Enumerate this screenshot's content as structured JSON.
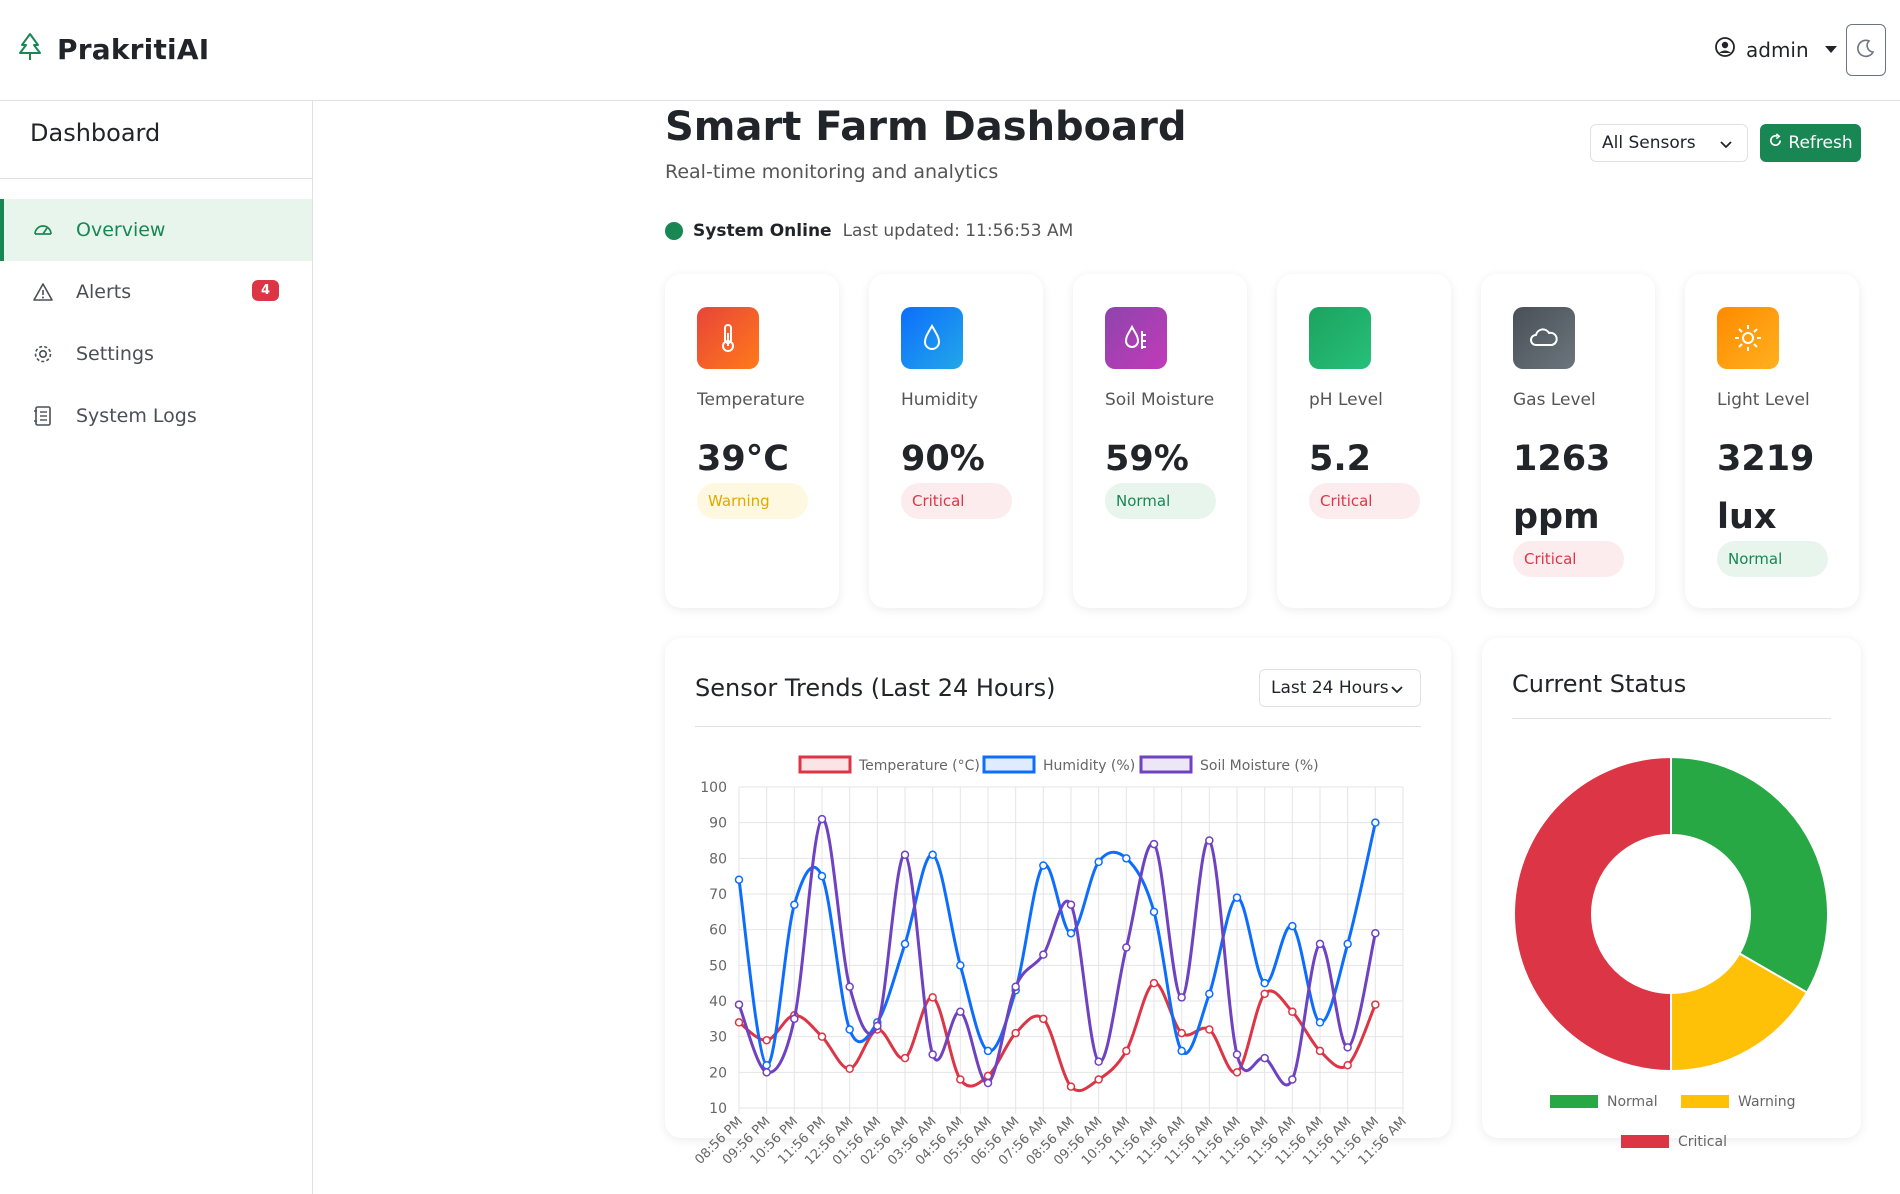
{
  "app": {
    "brand": "PrakritiAI",
    "user": "admin"
  },
  "sidebar": {
    "title": "Dashboard",
    "items": [
      {
        "label": "Overview",
        "icon": "speedometer-icon",
        "active": true
      },
      {
        "label": "Alerts",
        "icon": "warning-triangle-icon",
        "badge": "4"
      },
      {
        "label": "Settings",
        "icon": "gear-icon"
      },
      {
        "label": "System Logs",
        "icon": "journal-icon"
      }
    ]
  },
  "header": {
    "title": "Smart Farm Dashboard",
    "subtitle": "Real-time monitoring and analytics",
    "sensor_filter": "All Sensors",
    "refresh_label": "Refresh"
  },
  "system": {
    "status": "System Online",
    "last_updated": "Last updated: 11:56:53 AM"
  },
  "metrics": [
    {
      "label": "Temperature",
      "value": "39°C",
      "status": "Warning",
      "icon": "thermometer-icon",
      "color": "#f0542b"
    },
    {
      "label": "Humidity",
      "value": "90%",
      "status": "Critical",
      "icon": "droplet-icon",
      "color": "#1a8ae6"
    },
    {
      "label": "Soil Moisture",
      "value": "59%",
      "status": "Normal",
      "icon": "moisture-icon",
      "color": "#a83bbf"
    },
    {
      "label": "pH Level",
      "value": "5.2",
      "status": "Critical",
      "icon": "ph-icon",
      "color": "#20b068"
    },
    {
      "label": "Gas Level",
      "value": "1263 ppm",
      "status": "Critical",
      "icon": "cloud-icon",
      "color": "#5b6068"
    },
    {
      "label": "Light Level",
      "value": "3219 lux",
      "status": "Normal",
      "icon": "sun-icon",
      "color": "#ff9d0a"
    }
  ],
  "trend": {
    "title": "Sensor Trends (Last 24 Hours)",
    "range": "Last 24 Hours"
  },
  "status_panel": {
    "title": "Current Status"
  },
  "chart_data": [
    {
      "type": "line",
      "x": [
        "08:56 PM",
        "09:56 PM",
        "10:56 PM",
        "11:56 PM",
        "12:56 AM",
        "01:56 AM",
        "02:56 AM",
        "03:56 AM",
        "04:56 AM",
        "05:56 AM",
        "06:56 AM",
        "07:56 AM",
        "08:56 AM",
        "09:56 AM",
        "10:56 AM",
        "11:56 AM",
        "11:56 AM",
        "11:56 AM",
        "11:56 AM",
        "11:56 AM",
        "11:56 AM",
        "11:56 AM",
        "11:56 AM",
        "11:56 AM",
        "11:56 AM"
      ],
      "series": [
        {
          "name": "Temperature (°C)",
          "color": "#dc3545",
          "values": [
            34,
            29,
            36,
            30,
            21,
            32,
            24,
            41,
            18,
            19,
            31,
            35,
            16,
            18,
            26,
            45,
            31,
            32,
            20,
            42,
            37,
            26,
            22,
            39
          ]
        },
        {
          "name": "Humidity (%)",
          "color": "#0d6efd",
          "values": [
            74,
            22,
            67,
            75,
            32,
            34,
            56,
            81,
            50,
            26,
            43,
            78,
            59,
            79,
            80,
            65,
            26,
            42,
            69,
            45,
            61,
            34,
            56,
            90
          ]
        },
        {
          "name": "Soil Moisture (%)",
          "color": "#6f42c1",
          "values": [
            39,
            20,
            35,
            91,
            44,
            33,
            81,
            25,
            37,
            17,
            44,
            53,
            67,
            23,
            55,
            84,
            41,
            85,
            25,
            24,
            18,
            56,
            27,
            59
          ]
        }
      ],
      "ylim": [
        10,
        100
      ],
      "yticks": [
        100,
        90,
        80,
        70,
        60,
        50,
        40,
        30,
        20,
        10
      ],
      "grid": true,
      "legend": "top"
    },
    {
      "type": "pie",
      "categories": [
        "Normal",
        "Warning",
        "Critical"
      ],
      "values": [
        2,
        1,
        3
      ],
      "colors": [
        "#28a745",
        "#ffc107",
        "#dc3545"
      ],
      "legend": "bottom"
    }
  ]
}
